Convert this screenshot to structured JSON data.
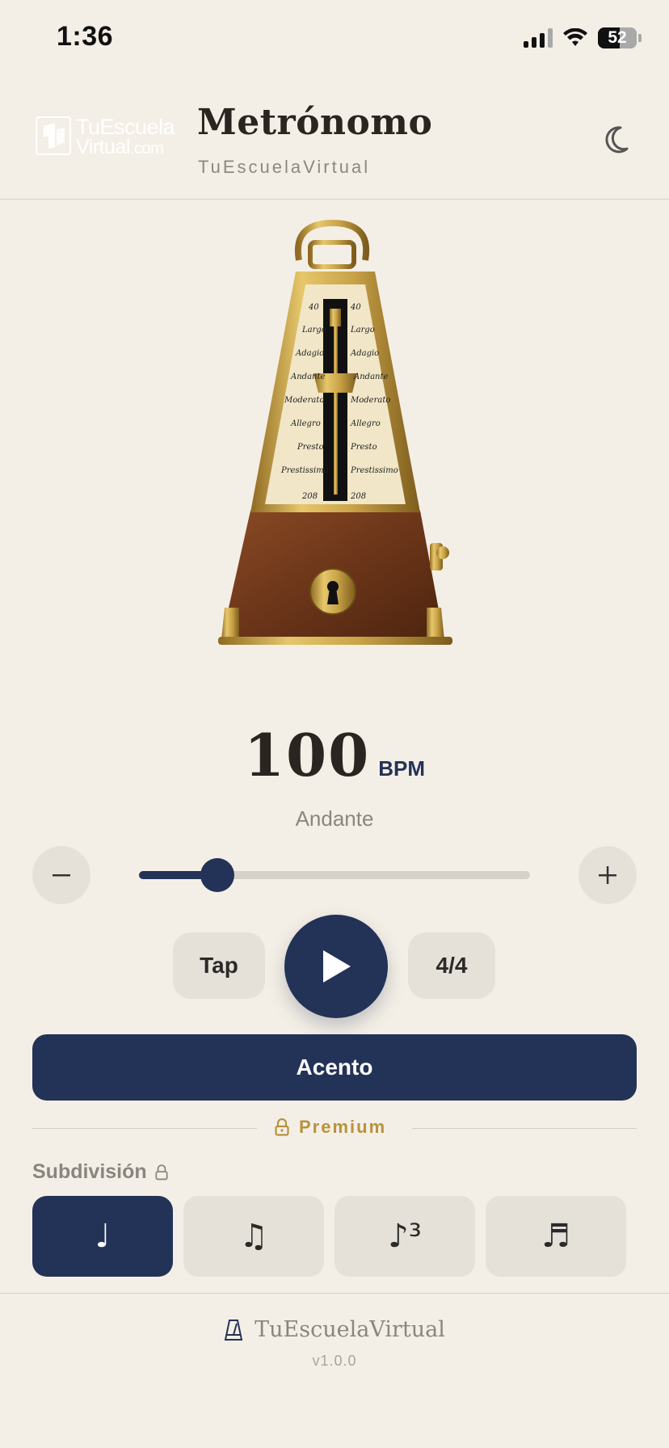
{
  "status_bar": {
    "time": "1:36",
    "battery": "52"
  },
  "header": {
    "logo_line1": "TuEscuela",
    "logo_line2": "Virtual",
    "logo_line2_suffix": ".com",
    "title": "Metrónomo",
    "subtitle": "TuEscuelaVirtual",
    "theme_icon": "moon-icon"
  },
  "metronome_scale": {
    "markings": [
      "40",
      "Largo",
      "Adagio",
      "Andante",
      "Moderato",
      "Allegro",
      "Presto",
      "Prestissimo",
      "208"
    ]
  },
  "tempo": {
    "bpm": "100",
    "unit": "BPM",
    "name": "Andante",
    "slider_fraction": 0.2
  },
  "controls": {
    "tap_label": "Tap",
    "time_signature": "4/4",
    "accent_label": "Acento"
  },
  "premium": {
    "label": "Premium"
  },
  "subdivision": {
    "label": "Subdivisión",
    "options": [
      "♩",
      "♫",
      "♪³",
      "♬"
    ],
    "active_index": 0
  },
  "footer": {
    "brand": "TuEscuelaVirtual",
    "version": "v1.0.0"
  },
  "colors": {
    "accent": "#233257",
    "background": "#f4efe6",
    "premium": "#b8923e",
    "wood": "#6b3519",
    "brass": "#c9a348"
  }
}
